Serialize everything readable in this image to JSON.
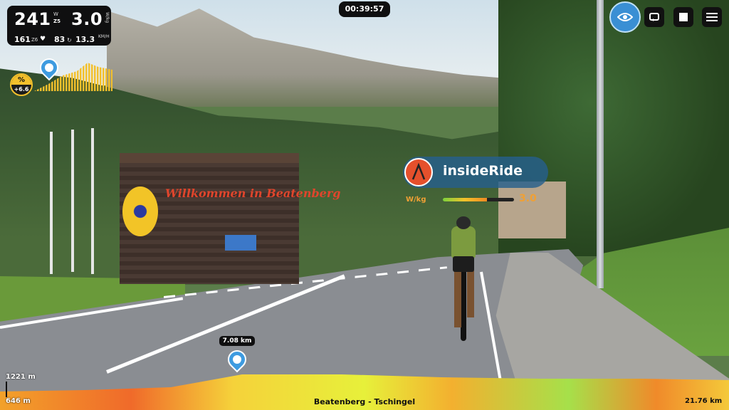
{
  "stats": {
    "power": "241",
    "power_unit": "W",
    "zone_top": "Z5",
    "wkg": "3.0",
    "wkg_unit": "W/kg",
    "heart_rate": "161",
    "hr_zone": "Z6",
    "cadence": "83",
    "speed": "13.3",
    "speed_unit": "KM/H"
  },
  "grade": {
    "symbol": "%",
    "value": "+6.6"
  },
  "timer": "00:39:57",
  "banner": {
    "brand": "insideRide",
    "metric_label": "W/kg",
    "metric_value": "3.0",
    "metric_fraction": 0.62
  },
  "distance_marker": "7.08 km",
  "profile": {
    "max_elevation": "1221 m",
    "min_elevation": "646 m",
    "route_name": "Beatenberg - Tschingel",
    "total_distance": "21.76 km"
  },
  "scene": {
    "building_sign": "Willkommen in Beatenberg"
  },
  "icons": {
    "view": "eye-icon",
    "camera": "camera-switch-icon",
    "stop": "stop-icon",
    "menu": "menu-icon"
  },
  "colors": {
    "accent": "#3a8fd4",
    "wkg": "#f0a034",
    "grade": "#f3c02c"
  }
}
